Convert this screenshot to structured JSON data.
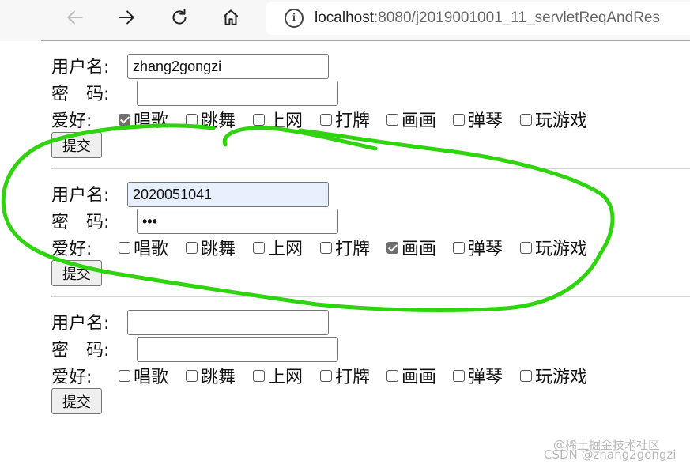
{
  "browser": {
    "url_host": "localhost",
    "url_path": ":8080/j2019001001_11_servletReqAndRes",
    "info_symbol": "i"
  },
  "forms": [
    {
      "username_label": "用户名:",
      "password_label": "密　码:",
      "hobby_label": "爱好:",
      "username_value": "zhang2gongzi",
      "password_value": "",
      "hobbies": [
        {
          "label": "唱歌",
          "checked": true
        },
        {
          "label": "跳舞",
          "checked": false
        },
        {
          "label": "上网",
          "checked": false
        },
        {
          "label": "打牌",
          "checked": false
        },
        {
          "label": "画画",
          "checked": false
        },
        {
          "label": "弹琴",
          "checked": false
        },
        {
          "label": "玩游戏",
          "checked": false
        }
      ],
      "submit_label": "提交"
    },
    {
      "username_label": "用户名:",
      "password_label": "密　码:",
      "hobby_label": "爱好:",
      "username_value": "2020051041",
      "password_value": "•••",
      "hobbies": [
        {
          "label": "唱歌",
          "checked": false
        },
        {
          "label": "跳舞",
          "checked": false
        },
        {
          "label": "上网",
          "checked": false
        },
        {
          "label": "打牌",
          "checked": false
        },
        {
          "label": "画画",
          "checked": true
        },
        {
          "label": "弹琴",
          "checked": false
        },
        {
          "label": "玩游戏",
          "checked": false
        }
      ],
      "submit_label": "提交"
    },
    {
      "username_label": "用户名:",
      "password_label": "密　码:",
      "hobby_label": "爱好:",
      "username_value": "",
      "password_value": "",
      "hobbies": [
        {
          "label": "唱歌",
          "checked": false
        },
        {
          "label": "跳舞",
          "checked": false
        },
        {
          "label": "上网",
          "checked": false
        },
        {
          "label": "打牌",
          "checked": false
        },
        {
          "label": "画画",
          "checked": false
        },
        {
          "label": "弹琴",
          "checked": false
        },
        {
          "label": "玩游戏",
          "checked": false
        }
      ],
      "submit_label": "提交"
    }
  ],
  "watermark": {
    "line1": "@稀土掘金技术社区",
    "line2": "CSDN @zhang2gongzi"
  },
  "colors": {
    "annotation": "#2fd40f",
    "autofill": "#e8f0fe"
  }
}
